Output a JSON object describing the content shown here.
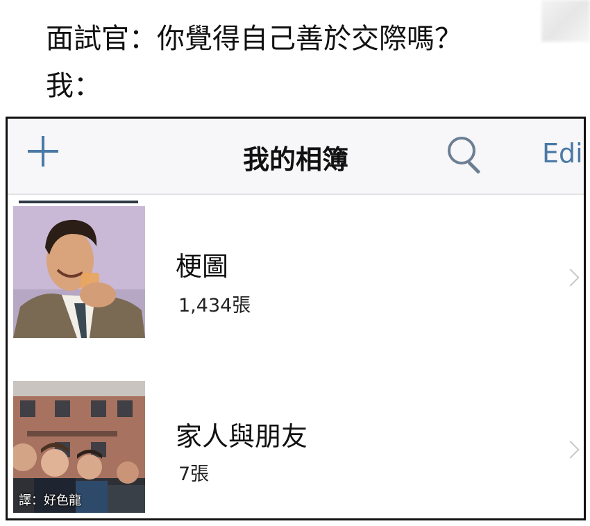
{
  "caption": {
    "question": "面試官：你覺得自己善於交際嗎？",
    "answer": "我："
  },
  "navbar": {
    "title": "我的相簿",
    "edit_label": "Edi",
    "add_icon": "plus-icon",
    "search_icon": "search-icon",
    "accent_color": "#4a79a6"
  },
  "albums": [
    {
      "name": "梗圖",
      "count": "1,434張",
      "thumbnail": "man-drinking-laughing-photo"
    },
    {
      "name": "家人與朋友",
      "count": "7張",
      "thumbnail": "group-in-front-of-brick-building-photo",
      "watermark": "譯：好色龍"
    }
  ]
}
